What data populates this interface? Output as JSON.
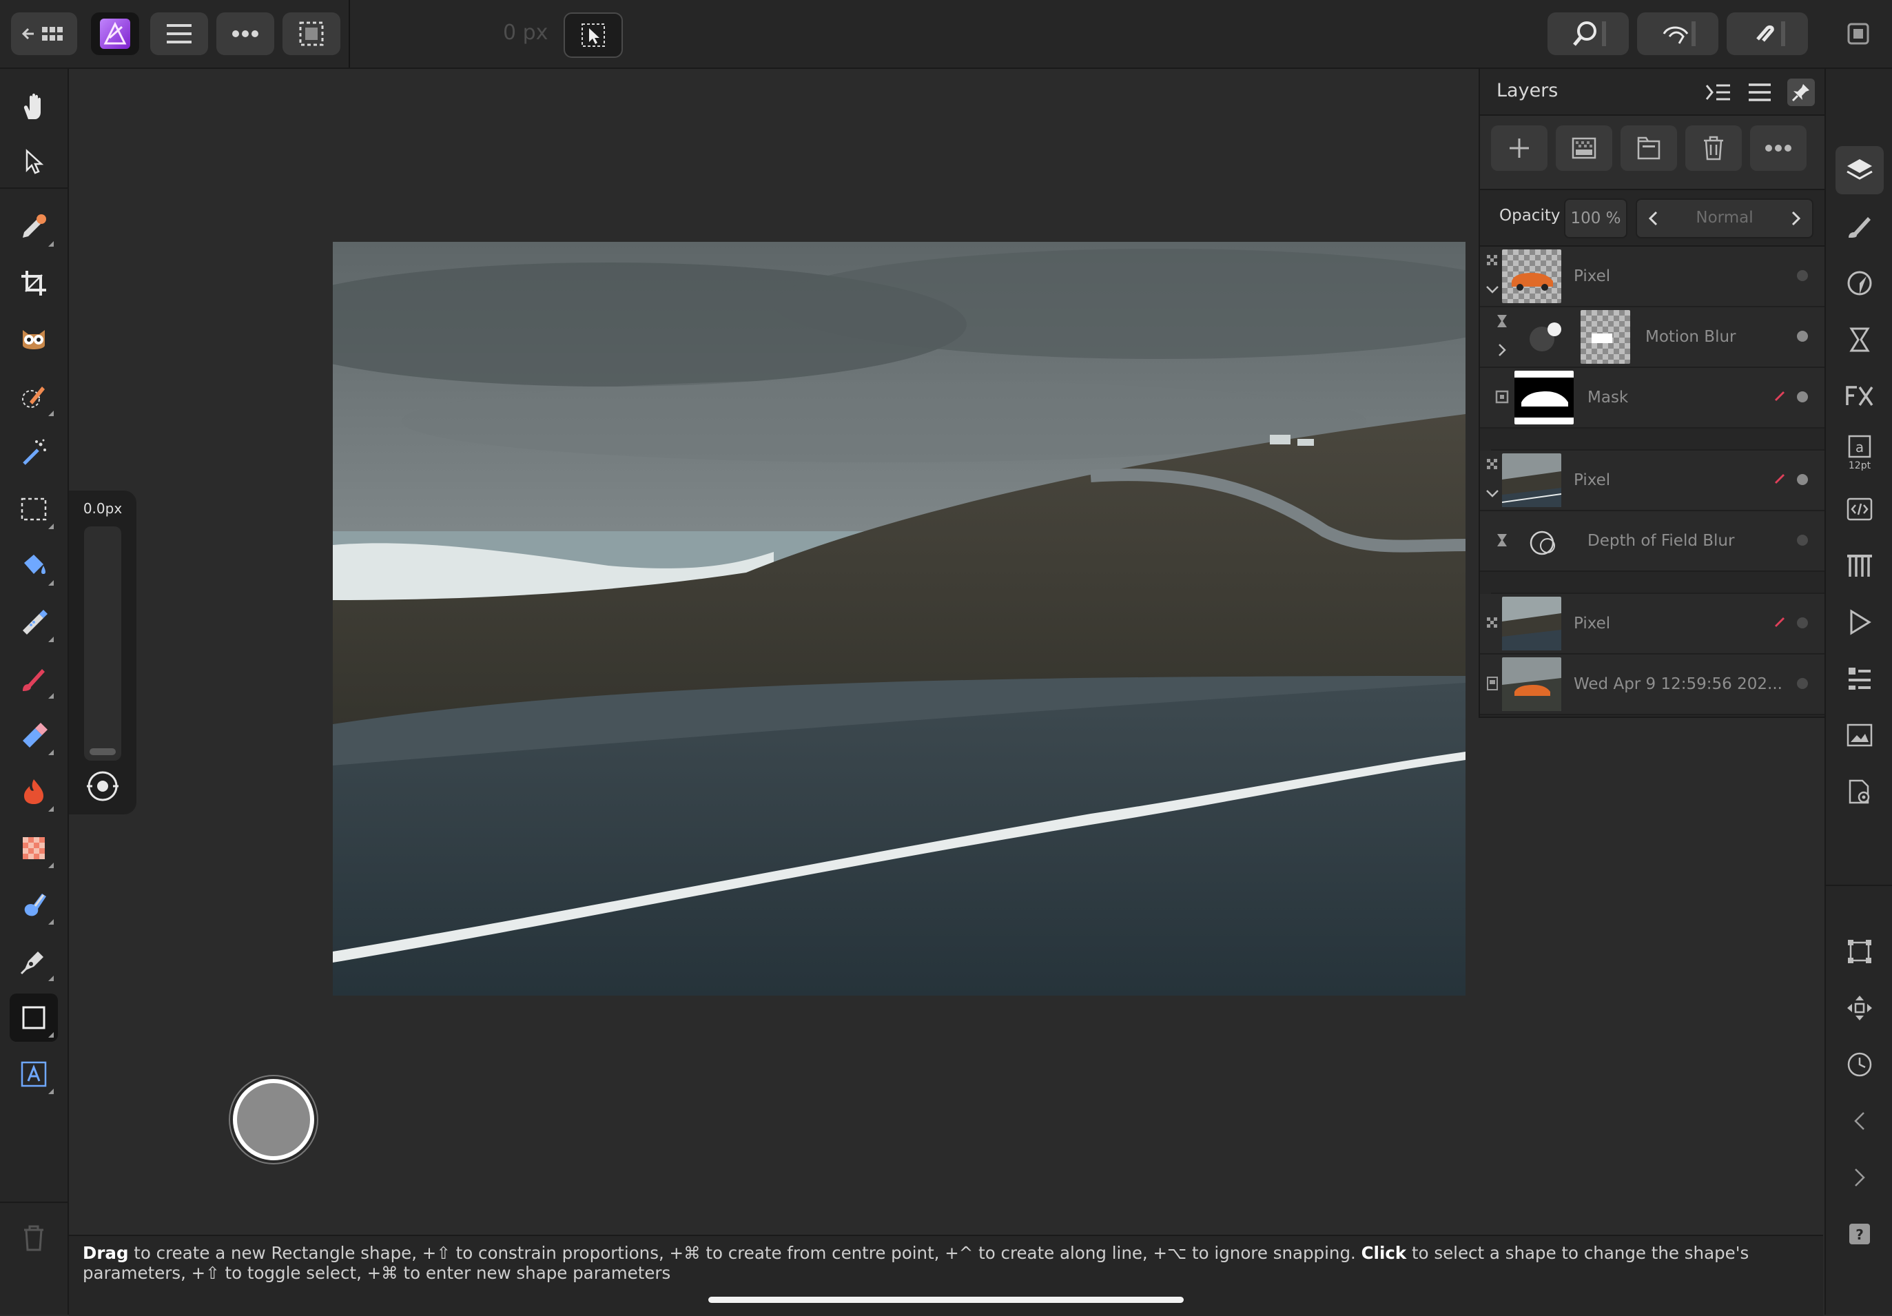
{
  "top_bar": {
    "units_readout": "0 px"
  },
  "brush_slider": {
    "value": "0.0px",
    "level": 0.0
  },
  "layers_panel": {
    "title": "Layers",
    "opacity_label": "Opacity",
    "opacity_value": "100 %",
    "blend_mode": "Normal",
    "layers": [
      {
        "name": "Pixel"
      },
      {
        "name": "Motion Blur"
      },
      {
        "name": "Mask"
      },
      {
        "name": "Pixel"
      },
      {
        "name": "Depth of Field Blur"
      },
      {
        "name": "Pixel"
      },
      {
        "name": "Wed Apr  9 12:59:56 202..."
      }
    ]
  },
  "right_bar": {
    "text_size_label": "12pt"
  },
  "status_bar": {
    "drag_word": "Drag",
    "drag_text": " to create a new Rectangle shape, +⇧ to constrain proportions, +⌘ to create from centre point, +^ to create along line, +⌥ to ignore snapping. ",
    "click_word": "Click",
    "click_text": " to select a shape to change the shape's parameters, +⇧ to toggle select, +⌘ to enter new shape parameters"
  },
  "colors": {
    "accent": "#a855f7",
    "panel": "#262626",
    "canvas": "#2b2b2b",
    "brush_red": "#e0405a"
  }
}
